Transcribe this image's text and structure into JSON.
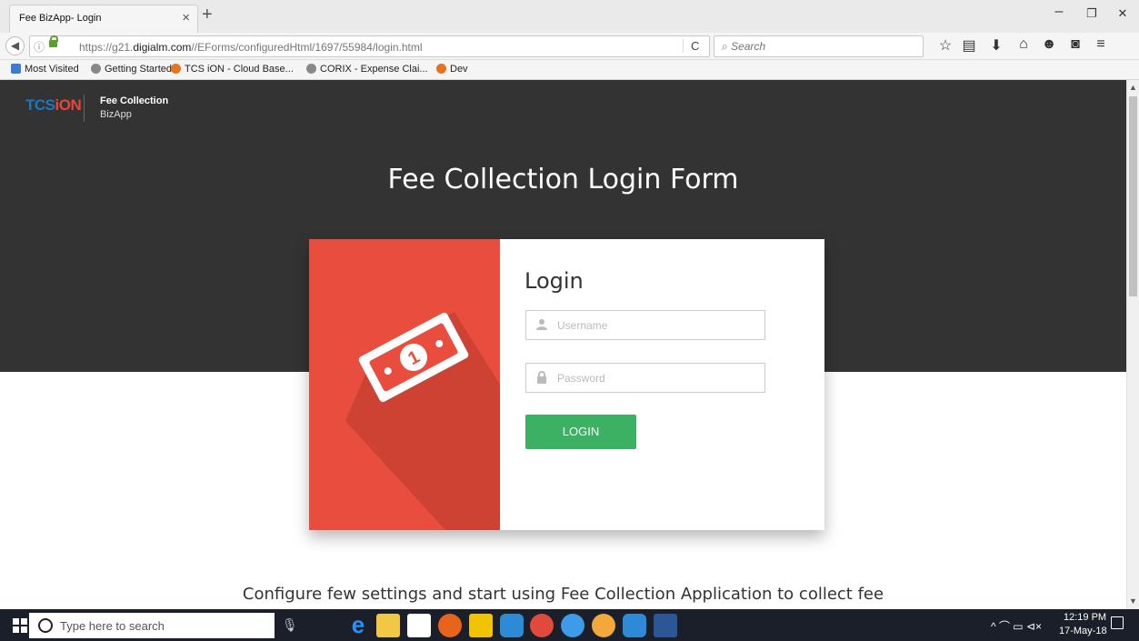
{
  "browser": {
    "tab_title": "Fee BizApp- Login",
    "tab_close": "×",
    "new_tab": "+",
    "window_controls": {
      "minimize": "–",
      "restore": "❐",
      "close": "✕"
    },
    "url_prefix": "https://g21.",
    "url_domain": "digialm.com",
    "url_path": "//EForms/configuredHtml/1697/55984/login.html",
    "reload": "C",
    "search_placeholder": "Search",
    "toolbar_icons": [
      "star-icon",
      "reading-list-icon",
      "download-icon",
      "home-icon",
      "chat-icon",
      "pocket-icon",
      "menu-icon"
    ],
    "bookmarks": [
      {
        "label": "Most Visited",
        "icon": "most-visited-icon"
      },
      {
        "label": "Getting Started",
        "icon": "globe-icon"
      },
      {
        "label": "TCS iON - Cloud Base...",
        "icon": "tcs-icon"
      },
      {
        "label": "CORIX - Expense Clai...",
        "icon": "globe-icon"
      },
      {
        "label": "Dev",
        "icon": "tcs-icon"
      }
    ]
  },
  "page": {
    "logo_tcs": "TCS",
    "logo_ion": "iON",
    "app_name": "Fee Collection",
    "app_sub": "BizApp",
    "hero_title": "Fee Collection Login Form",
    "login": {
      "title": "Login",
      "username_placeholder": "Username",
      "password_placeholder": "Password",
      "button": "LOGIN"
    },
    "tagline_start": "Configure few settings and start using ",
    "tagline_app": "Fee Collection Application",
    "tagline_end": " to collect fee"
  },
  "taskbar": {
    "search_placeholder": "Type here to search",
    "time": "12:19 PM",
    "date": "17-May-18",
    "tray_icons": "^  ⌒  ▭  ⊲×"
  },
  "colors": {
    "hero_bg": "#333333",
    "card_accent": "#e84d3d",
    "login_button": "#3cb063",
    "logo_blue": "#1a78c2",
    "logo_red": "#e8463a"
  }
}
